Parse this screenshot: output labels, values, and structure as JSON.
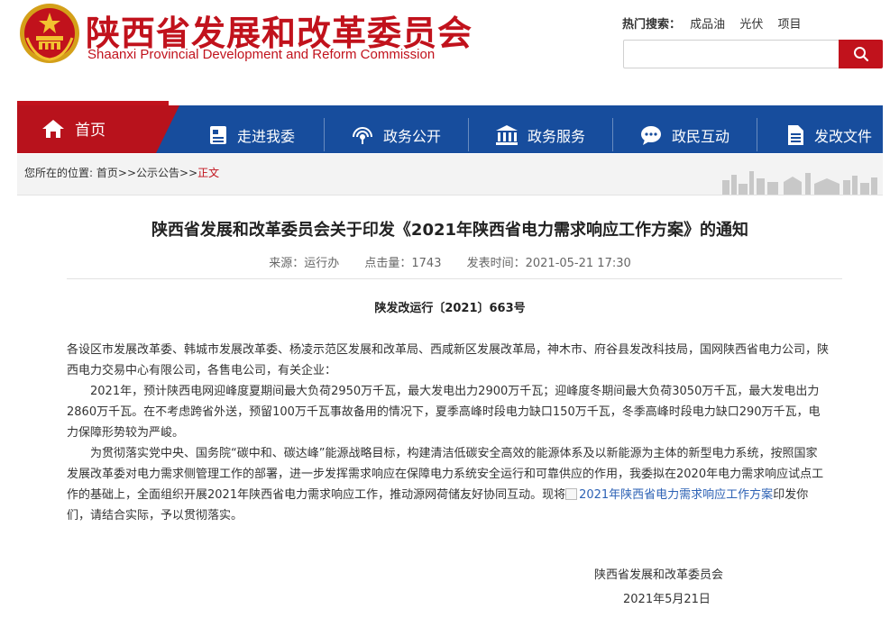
{
  "header": {
    "title_cn": "陕西省发展和改革委员会",
    "title_en": "Shaanxi Provincial Development and Reform Commission",
    "hot_search_label": "热门搜索：",
    "hot_search_terms": [
      "成品油",
      "光伏",
      "项目"
    ],
    "search_placeholder": ""
  },
  "nav": {
    "home": "首页",
    "items": [
      {
        "label": "走进我委",
        "icon": "document-icon"
      },
      {
        "label": "政务公开",
        "icon": "signal-icon"
      },
      {
        "label": "政务服务",
        "icon": "building-icon"
      },
      {
        "label": "政民互动",
        "icon": "chat-icon"
      },
      {
        "label": "发改文件",
        "icon": "file-icon"
      }
    ]
  },
  "breadcrumb": {
    "prefix": "您所在的位置:",
    "items": [
      "首页",
      "公示公告"
    ],
    "sep": ">>",
    "current": "正文"
  },
  "article": {
    "title": "陕西省发展和改革委员会关于印发《2021年陕西省电力需求响应工作方案》的通知",
    "source": "来源：运行办",
    "clicks": "点击量：1743",
    "date": "发表时间：2021-05-21 17:30",
    "doc_no": "陕发改运行〔2021〕663号",
    "addressee": "各设区市发展改革委、韩城市发展改革委、杨凌示范区发展和改革局、西咸新区发展改革局，神木市、府谷县发改科技局，国网陕西省电力公司，陕西电力交易中心有限公司，各售电公司，有关企业：",
    "para1": "2021年，预计陕西电网迎峰度夏期间最大负荷2950万千瓦，最大发电出力2900万千瓦；迎峰度冬期间最大负荷3050万千瓦，最大发电出力2860万千瓦。在不考虑跨省外送，预留100万千瓦事故备用的情况下，夏季高峰时段电力缺口150万千瓦，冬季高峰时段电力缺口290万千瓦，电力保障形势较为严峻。",
    "para2_before": "为贯彻落实党中央、国务院“碳中和、碳达峰”能源战略目标，构建清洁低碳安全高效的能源体系及以新能源为主体的新型电力系统，按照国家发展改革委对电力需求侧管理工作的部署，进一步发挥需求响应在保障电力系统安全运行和可靠供应的作用，我委拟在2020年电力需求响应试点工作的基础上，全面组织开展2021年陕西省电力需求响应工作，推动源网荷储友好协同互动。现将",
    "para2_link": "2021年陕西省电力需求响应工作方案",
    "para2_after": "印发你们，请结合实际，予以贯彻落实。",
    "sign_org": "陕西省发展和改革委员会",
    "sign_date": "2021年5月21日"
  },
  "colors": {
    "brand_red": "#c1121c",
    "nav_blue": "#174d9d",
    "link_blue": "#2d62b5"
  }
}
